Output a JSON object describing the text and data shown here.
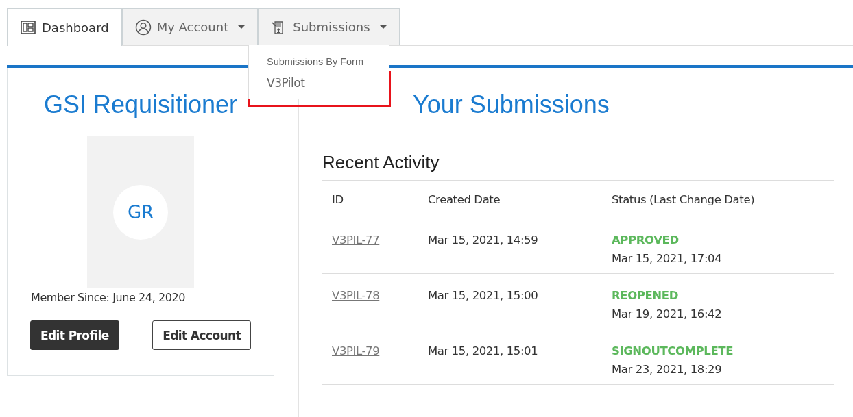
{
  "tabs": [
    {
      "label": "Dashboard",
      "kind": "dashboard",
      "selected": true,
      "dropdown": false
    },
    {
      "label": "My Account",
      "kind": "account",
      "selected": false,
      "dropdown": true
    },
    {
      "label": "Submissions",
      "kind": "submissions",
      "selected": false,
      "dropdown": true
    }
  ],
  "submissions_menu": {
    "header": "Submissions By Form",
    "items": [
      {
        "label": "V3Pilot",
        "highlighted": true
      }
    ]
  },
  "profile": {
    "name": "GSI Requisitioner",
    "initials": "GR",
    "member_since": "Member Since: June 24, 2020",
    "buttons": [
      {
        "label": "Edit Profile",
        "kind": "primary"
      },
      {
        "label": "Edit Account",
        "kind": "outline"
      }
    ]
  },
  "main": {
    "title": "Your Submissions",
    "section_title": "Recent Activity",
    "table": {
      "columns": [
        "ID",
        "Created Date",
        "Status (Last Change Date)"
      ],
      "rows": [
        {
          "id": "V3PIL-77",
          "created": "Mar 15, 2021, 14:59",
          "status": "APPROVED",
          "changed": "Mar 15, 2021, 17:04"
        },
        {
          "id": "V3PIL-78",
          "created": "Mar 15, 2021, 15:00",
          "status": "REOPENED",
          "changed": "Mar 19, 2021, 16:42"
        },
        {
          "id": "V3PIL-79",
          "created": "Mar 15, 2021, 15:01",
          "status": "SIGNOUTCOMPLETE",
          "changed": "Mar 23, 2021, 18:29"
        }
      ]
    }
  }
}
